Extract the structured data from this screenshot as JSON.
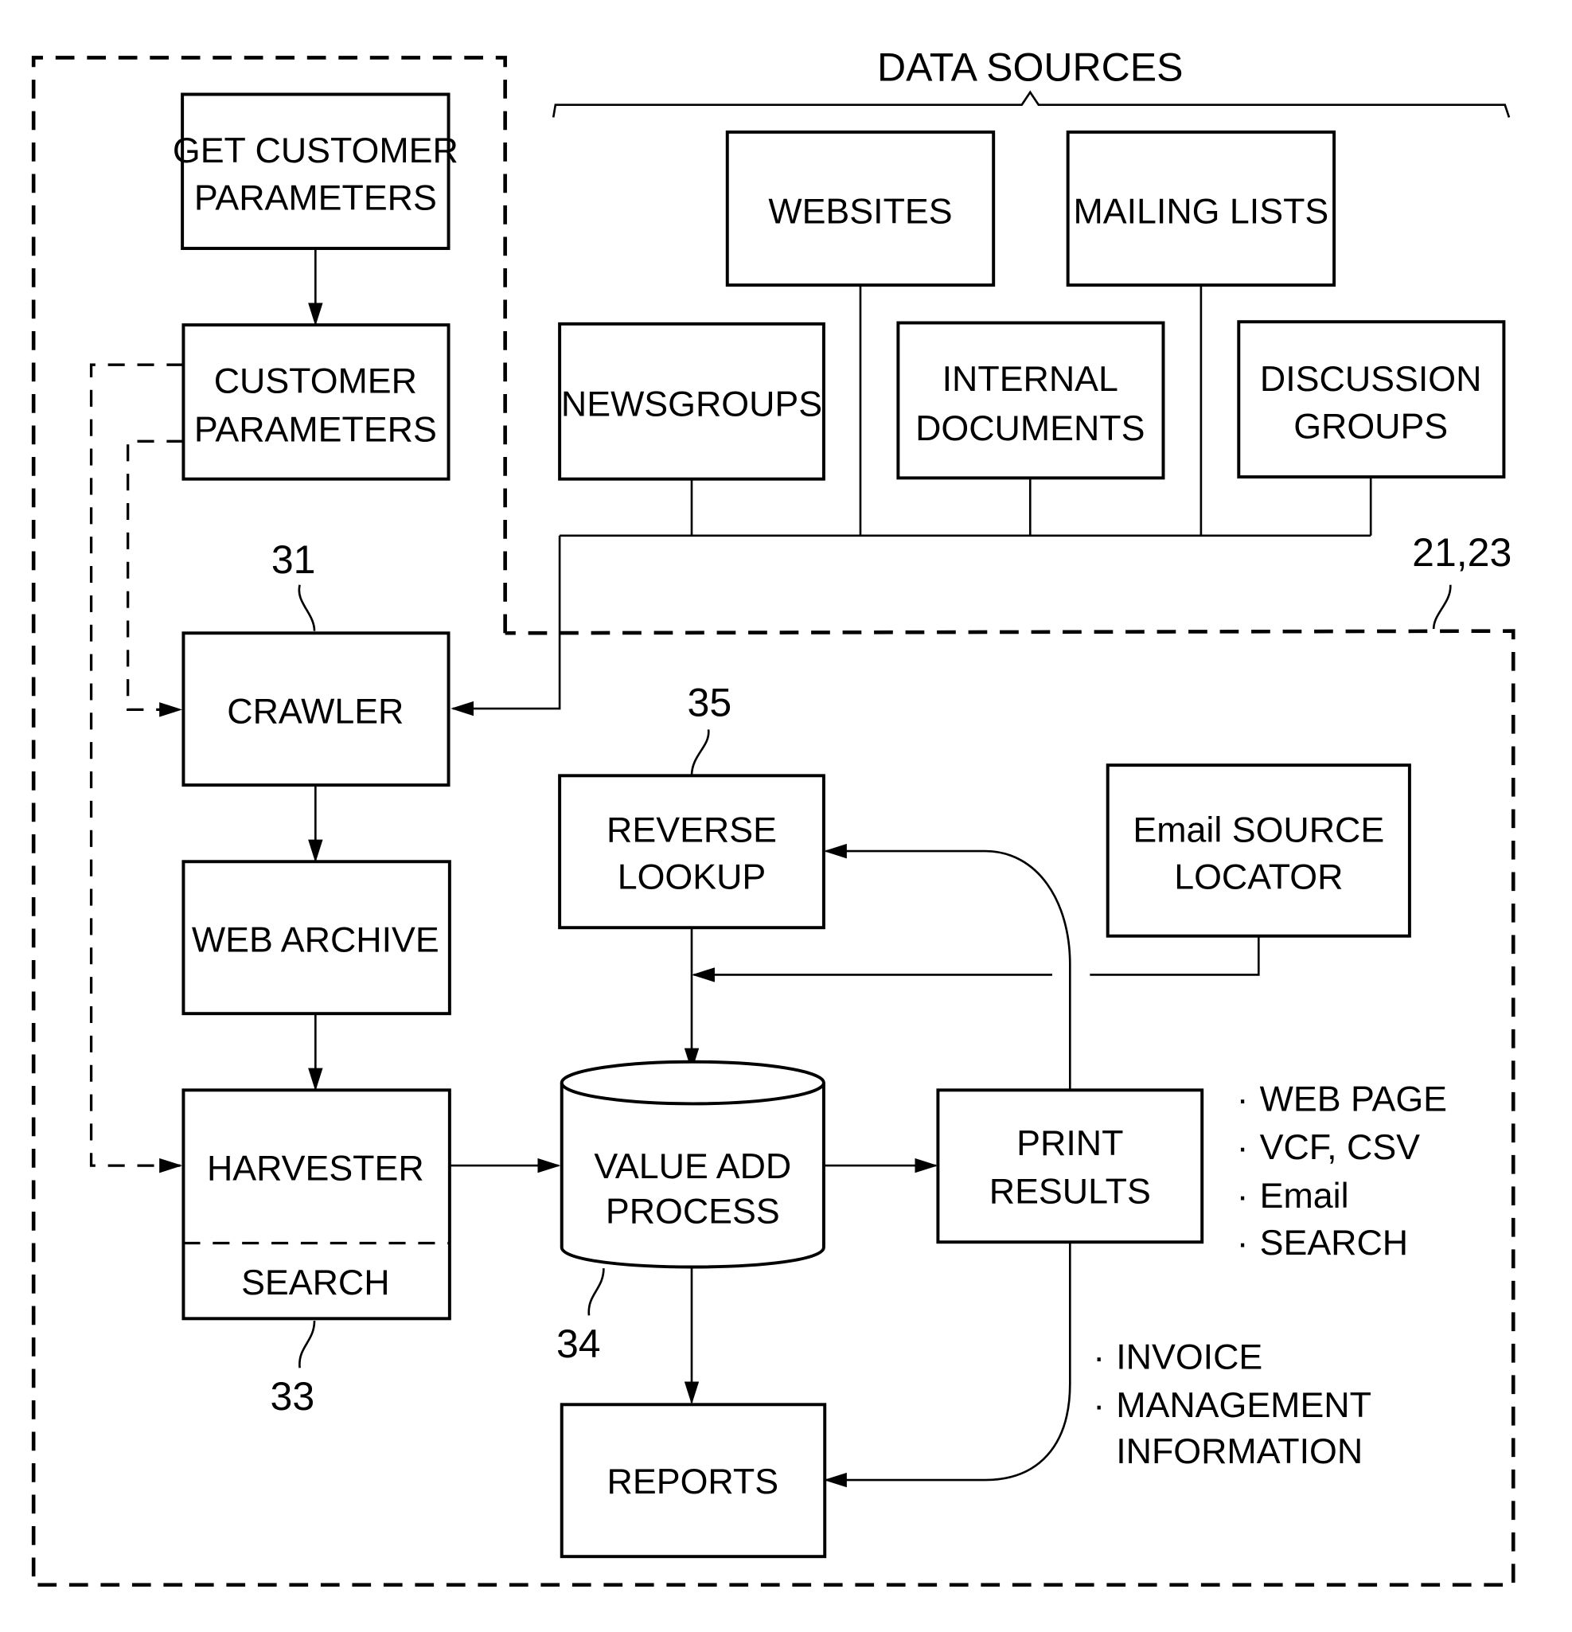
{
  "diagram": {
    "data_sources_title": "DATA SOURCES",
    "boxes": {
      "get_customer_parameters": [
        "GET CUSTOMER",
        "PARAMETERS"
      ],
      "customer_parameters": [
        "CUSTOMER",
        "PARAMETERS"
      ],
      "websites": [
        "WEBSITES"
      ],
      "mailing_lists": [
        "MAILING LISTS"
      ],
      "newsgroups": [
        "NEWSGROUPS"
      ],
      "internal_documents": [
        "INTERNAL",
        "DOCUMENTS"
      ],
      "discussion_groups": [
        "DISCUSSION",
        "GROUPS"
      ],
      "crawler": [
        "CRAWLER"
      ],
      "web_archive": [
        "WEB ARCHIVE"
      ],
      "harvester": [
        "HARVESTER"
      ],
      "harvester_search": [
        "SEARCH"
      ],
      "reverse_lookup": [
        "REVERSE",
        "LOOKUP"
      ],
      "email_source_locator": [
        "Email SOURCE",
        "LOCATOR"
      ],
      "value_add_process": [
        "VALUE ADD",
        "PROCESS"
      ],
      "print_results": [
        "PRINT",
        "RESULTS"
      ],
      "reports": [
        "REPORTS"
      ]
    },
    "output_formats": [
      "WEB PAGE",
      "VCF, CSV",
      "Email",
      "SEARCH"
    ],
    "report_items": [
      "INVOICE",
      "MANAGEMENT",
      "INFORMATION"
    ],
    "bullet": "·",
    "reference_numerals": {
      "crawler": "31",
      "harvester": "33",
      "value_add": "34",
      "reverse_lookup": "35",
      "system": "21,23"
    }
  }
}
